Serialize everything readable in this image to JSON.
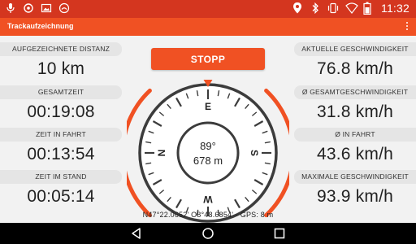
{
  "status_bar": {
    "left_icons": [
      "microphone-icon",
      "whatsapp-icon",
      "image-icon",
      "android-debug-icon"
    ],
    "right_icons": [
      "location-pin-icon",
      "bluetooth-icon",
      "vibrate-icon",
      "wifi-icon",
      "battery-icon"
    ],
    "time": "11:32"
  },
  "app_bar": {
    "title": "Trackaufzeichnung",
    "menu_icon": "overflow-menu-icon"
  },
  "left_stats": [
    {
      "label": "AUFGEZEICHNETE DISTANZ",
      "value": "10 km"
    },
    {
      "label": "GESAMTZEIT",
      "value": "00:19:08"
    },
    {
      "label": "ZEIT IN FAHRT",
      "value": "00:13:54"
    },
    {
      "label": "ZEIT IM STAND",
      "value": "00:05:14"
    }
  ],
  "right_stats": [
    {
      "label": "AKTUELLE GESCHWINDIGKEIT",
      "value": "76.8 km/h"
    },
    {
      "label": "Ø GESAMTGESCHWINDIGKEIT",
      "value": "31.8 km/h"
    },
    {
      "label": "Ø IN FAHRT",
      "value": "43.6 km/h"
    },
    {
      "label": "MAXIMALE GESCHWINDIGKEIT",
      "value": "93.9 km/h"
    }
  ],
  "stop_button": {
    "label": "STOPP"
  },
  "compass": {
    "heading": "89°",
    "distance": "678 m",
    "cardinals": {
      "north": "N",
      "east": "E",
      "south": "S",
      "west": "W"
    },
    "rotation_deg": -90
  },
  "gps": {
    "text": "N47°22.0652' O8°48.6854' - GPS: 8 m"
  },
  "nav_bar": {
    "icons": [
      "back-icon",
      "home-icon",
      "recents-icon"
    ]
  },
  "colors": {
    "accent": "#f05123",
    "status_bar": "#d4361f",
    "panel": "#f2f2f2",
    "label_bg": "#e5e5e5",
    "compass_ring": "#3c3c3c"
  }
}
